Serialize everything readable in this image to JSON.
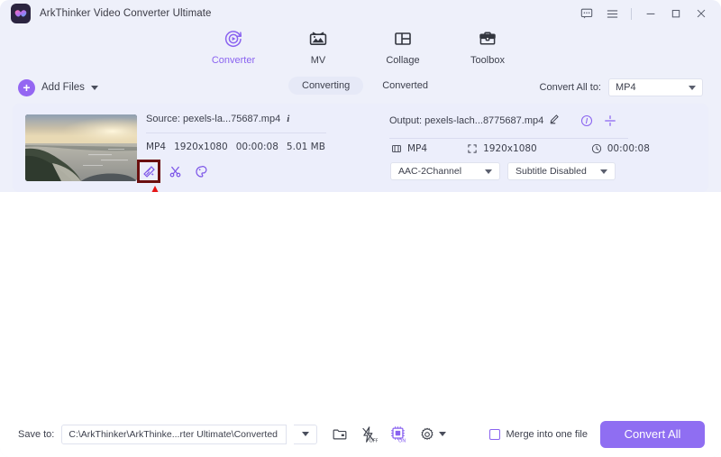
{
  "window": {
    "app_title": "ArkThinker Video Converter Ultimate",
    "logo_icon": "arkthinker-logo-icon",
    "controls": [
      {
        "name": "feedback-icon",
        "glyph": "speech-bubble"
      },
      {
        "name": "menu-icon",
        "glyph": "hamburger"
      },
      {
        "name": "minimize-icon",
        "glyph": "minus"
      },
      {
        "name": "maximize-icon",
        "glyph": "square"
      },
      {
        "name": "close-icon",
        "glyph": "x"
      }
    ]
  },
  "nav": {
    "items": [
      {
        "label": "Converter",
        "icon": "converter-icon",
        "active": true
      },
      {
        "label": "MV",
        "icon": "mv-icon",
        "active": false
      },
      {
        "label": "Collage",
        "icon": "collage-icon",
        "active": false
      },
      {
        "label": "Toolbox",
        "icon": "toolbox-icon",
        "active": false
      }
    ]
  },
  "toolbar": {
    "add_files_label": "Add Files",
    "add_files_icon": "plus-circle-icon",
    "tabs": [
      {
        "label": "Converting",
        "active": true
      },
      {
        "label": "Converted",
        "active": false
      }
    ],
    "convert_all_to_label": "Convert All to:",
    "convert_all_to_value": "MP4"
  },
  "file_card": {
    "thumbnail_alt": "beach-sunset-thumbnail",
    "source_label": "Source: pexels-la...75687.mp4",
    "source_info_icon": "info-italic-icon",
    "source_meta": [
      "MP4",
      "1920x1080",
      "00:00:08",
      "5.01 MB"
    ],
    "edit_tools": [
      {
        "name": "magic-wand-edit-icon",
        "highlighted": true
      },
      {
        "name": "scissors-trim-icon",
        "highlighted": false
      },
      {
        "name": "palette-effects-icon",
        "highlighted": false
      }
    ],
    "output_label": "Output: pexels-lach...8775687.mp4",
    "output_edit_icon": "pencil-icon",
    "output_info_icon": "info-circle-icon",
    "output_split_icon": "split-icon",
    "output_format": "MP4",
    "output_resolution": "1920x1080",
    "output_duration": "00:00:08",
    "audio_track": "AAC-2Channel",
    "subtitle_track": "Subtitle Disabled",
    "format_badge": "MP4"
  },
  "bottom": {
    "save_to_label": "Save to:",
    "save_to_path": "C:\\ArkThinker\\ArkThinke...rter Ultimate\\Converted",
    "folder_icon": "open-folder-icon",
    "hw_accel_icon": "lightning-icon",
    "hw_accel_state": "OFF",
    "gpu_icon": "gpu-chip-icon",
    "gpu_state": "ON",
    "settings_icon": "gear-icon",
    "merge_label": "Merge into one file",
    "merge_checked": false,
    "convert_all_label": "Convert All"
  },
  "annotation": {
    "arrow_name": "red-pointer-arrow",
    "arrow_color": "#e61515",
    "highlight_color": "#6b1010"
  },
  "colors": {
    "accent": "#8a63f0",
    "button": "#8f6ef2",
    "header_bg": "#eef0fa",
    "card_bg": "#eceefb"
  }
}
